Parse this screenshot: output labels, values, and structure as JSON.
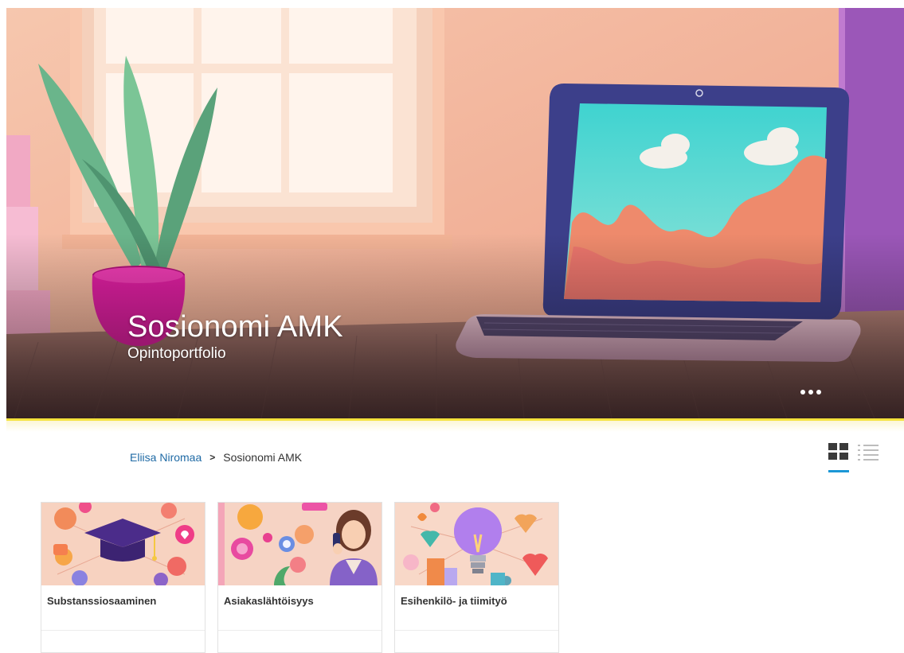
{
  "hero": {
    "title": "Sosionomi AMK",
    "subtitle": "Opintoportfolio",
    "more_icon": "more-dots-icon"
  },
  "breadcrumb": {
    "items": [
      "Eliisa Niromaa",
      "Sosionomi AMK"
    ],
    "separator_icon": "chevron-right-icon"
  },
  "view_toggle": {
    "active": "grid",
    "grid_icon": "grid-view-icon",
    "list_icon": "list-view-icon"
  },
  "cards": [
    {
      "title": "Substanssiosaaminen"
    },
    {
      "title": "Asiakaslähtöisyys"
    },
    {
      "title": "Esihenkilö- ja tiimityö"
    }
  ],
  "colors": {
    "accent_yellow": "#f4e23c",
    "link_blue": "#1f6aa5",
    "active_underline": "#1b97d6"
  }
}
